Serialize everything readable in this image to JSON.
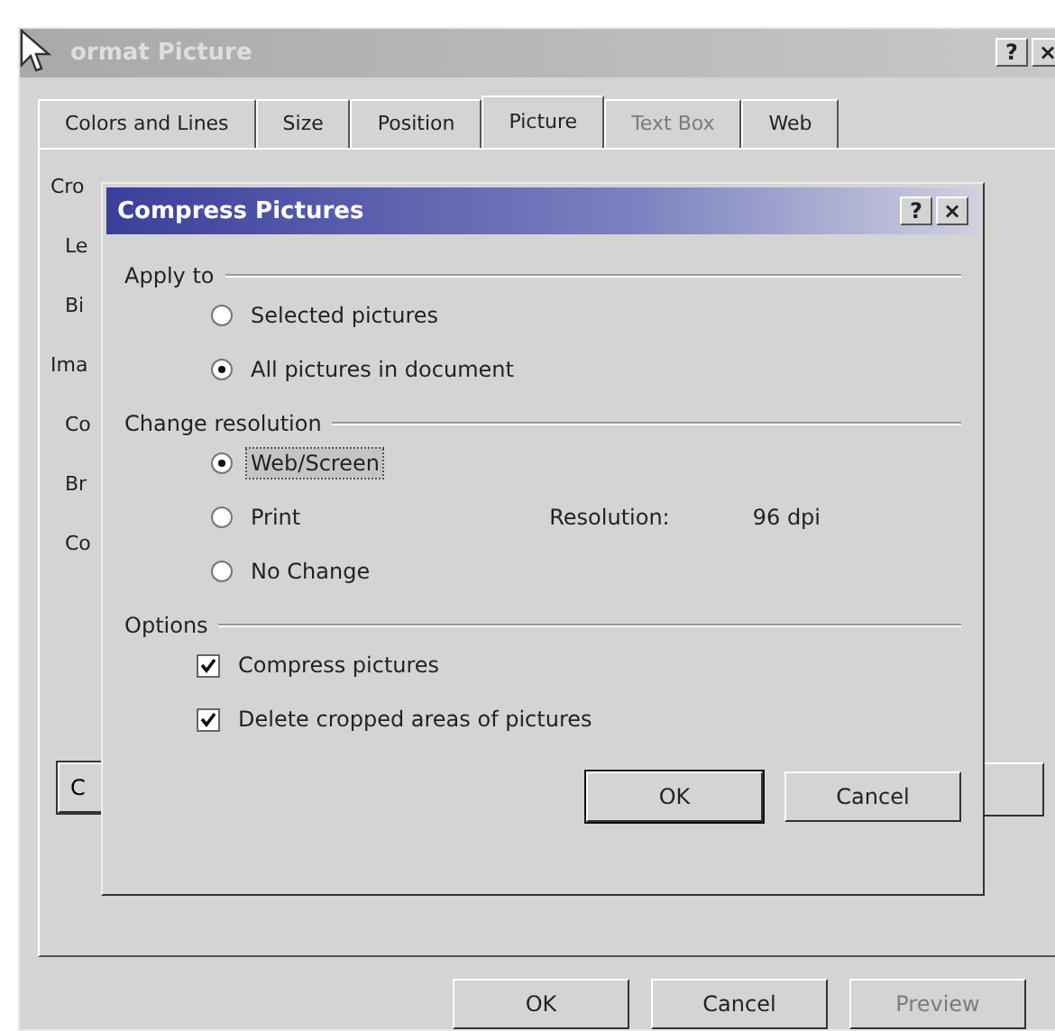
{
  "window": {
    "title": "ormat Picture",
    "help_button": "?",
    "close_button": "×"
  },
  "tabs": [
    {
      "label": "Colors and Lines",
      "selected": false,
      "disabled": false
    },
    {
      "label": "Size",
      "selected": false,
      "disabled": false
    },
    {
      "label": "Position",
      "selected": false,
      "disabled": false
    },
    {
      "label": "Picture",
      "selected": true,
      "disabled": false
    },
    {
      "label": "Text Box",
      "selected": false,
      "disabled": true
    },
    {
      "label": "Web",
      "selected": false,
      "disabled": false
    }
  ],
  "panel_labels": [
    {
      "kind": "heading",
      "text": "Cro"
    },
    {
      "kind": "label",
      "text": "Le"
    },
    {
      "kind": "label",
      "text": "Bi"
    },
    {
      "kind": "heading",
      "text": "Ima"
    },
    {
      "kind": "label",
      "text": "Co"
    },
    {
      "kind": "label",
      "text": "Br"
    },
    {
      "kind": "label",
      "text": "Co"
    }
  ],
  "panel_button": "C",
  "dialog": {
    "title": "Compress Pictures",
    "help_button": "?",
    "close_button": "×",
    "groups": [
      {
        "title": "Apply to",
        "items": [
          {
            "kind": "radio",
            "label": "Selected pictures",
            "selected": false
          },
          {
            "kind": "radio",
            "label": "All pictures in document",
            "selected": true
          }
        ]
      },
      {
        "title": "Change resolution",
        "items": [
          {
            "kind": "radio",
            "label": "Web/Screen",
            "selected": true,
            "focused": true
          },
          {
            "kind": "radio",
            "label": "Print",
            "selected": false,
            "focused": false
          },
          {
            "kind": "radio",
            "label": "No Change",
            "selected": false,
            "focused": false
          }
        ],
        "resolution_label": "Resolution:",
        "resolution_value": "96 dpi"
      },
      {
        "title": "Options",
        "items": [
          {
            "kind": "checkbox",
            "label": "Compress pictures",
            "checked": true
          },
          {
            "kind": "checkbox",
            "label": "Delete cropped areas of pictures",
            "checked": true
          }
        ]
      }
    ],
    "buttons": [
      {
        "label": "OK",
        "default": true
      },
      {
        "label": "Cancel",
        "default": false
      }
    ]
  },
  "buttons": [
    {
      "label": "OK",
      "disabled": false
    },
    {
      "label": "Cancel",
      "disabled": false
    },
    {
      "label": "Preview",
      "disabled": true
    }
  ]
}
